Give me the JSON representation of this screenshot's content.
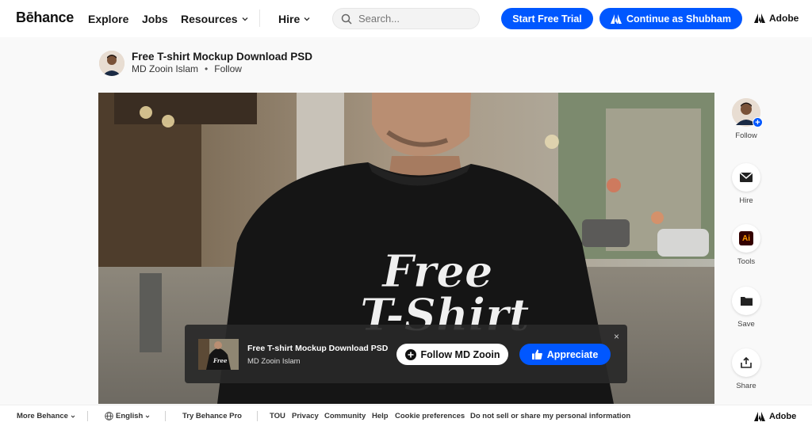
{
  "nav": {
    "logo": "Bēhance",
    "explore": "Explore",
    "jobs": "Jobs",
    "resources": "Resources",
    "hire": "Hire",
    "search_placeholder": "Search...",
    "start_trial": "Start Free Trial",
    "continue_as": "Continue as Shubham",
    "adobe": "Adobe"
  },
  "project": {
    "title": "Free T-shirt Mockup Download PSD",
    "author": "MD Zooin Islam",
    "follow": "Follow"
  },
  "sidebar": {
    "follow": "Follow",
    "hire": "Hire",
    "tools": "Tools",
    "save": "Save",
    "share": "Share"
  },
  "floatbar": {
    "title": "Free T-shirt Mockup Download PSD",
    "author": "MD Zooin Islam",
    "follow_button": "Follow MD Zooin",
    "appreciate_button": "Appreciate",
    "close": "×"
  },
  "footer": {
    "more_behance": "More Behance",
    "language": "English",
    "try_pro": "Try Behance Pro",
    "tou": "TOU",
    "privacy": "Privacy",
    "community": "Community",
    "help": "Help",
    "cookie": "Cookie preferences",
    "do_not_sell": "Do not sell or share my personal information",
    "adobe": "Adobe"
  },
  "hero": {
    "shirt_text_line1": "Free",
    "shirt_text_line2": "T-Shirt"
  },
  "colors": {
    "accent": "#0057ff",
    "floatbar_bg": "#282828"
  }
}
